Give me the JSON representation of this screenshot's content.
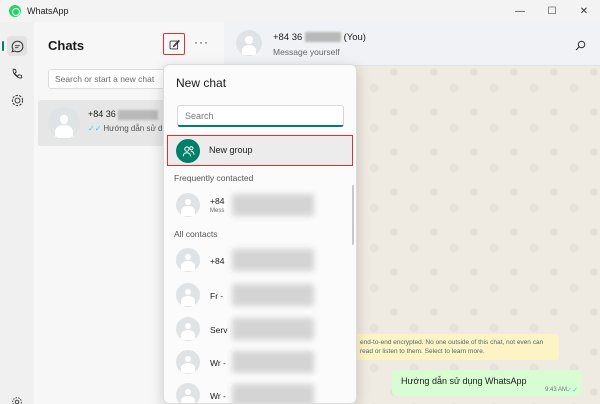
{
  "window": {
    "title": "WhatsApp",
    "controls": {
      "minimize": "—",
      "maximize": "☐",
      "close": "✕"
    }
  },
  "rail": {
    "items": [
      {
        "name": "chats-icon"
      },
      {
        "name": "calls-icon"
      },
      {
        "name": "status-icon"
      },
      {
        "name": "settings-icon"
      }
    ]
  },
  "chats": {
    "title": "Chats",
    "more_label": "···",
    "search_placeholder": "Search or start a new chat",
    "items": [
      {
        "name_prefix": "+84 36",
        "preview": "Hướng dẫn sử d"
      }
    ]
  },
  "conversation": {
    "name_prefix": "+84 36",
    "name_suffix": "(You)",
    "status": "Message yourself",
    "encryption_notice": "end-to-end encrypted. No one outside of this chat, not even can read or listen to them. Select to learn more.",
    "message": {
      "text": "Hướng dẫn sử dụng WhatsApp",
      "time": "9:43 AM",
      "ticks": "✓✓"
    }
  },
  "new_chat": {
    "title": "New chat",
    "search_placeholder": "Search",
    "new_group_label": "New group",
    "frequently_label": "Frequently contacted",
    "frequent": [
      {
        "name": "+84",
        "sub": "Mess"
      }
    ],
    "all_contacts_label": "All contacts",
    "contacts": [
      {
        "name": "+84"
      },
      {
        "name": "Fr -"
      },
      {
        "name": "Serv"
      },
      {
        "name": "Wr -"
      },
      {
        "name": "Wr -"
      }
    ]
  },
  "colors": {
    "accent": "#008069",
    "highlight": "#e03131",
    "outgoing_bubble": "#d9fdd3",
    "notice": "#fdf4c5"
  }
}
